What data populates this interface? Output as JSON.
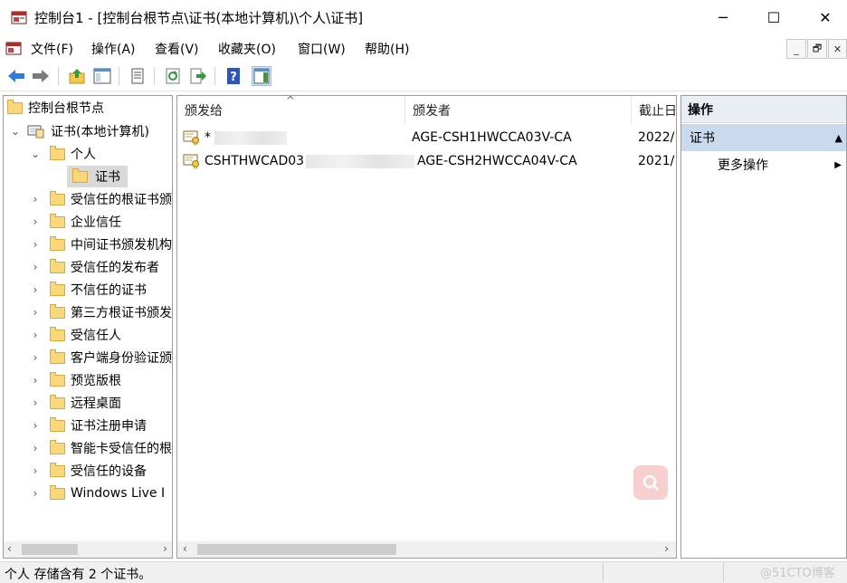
{
  "window": {
    "title": "控制台1 - [控制台根节点\\证书(本地计算机)\\个人\\证书]",
    "min_glyph": "─",
    "max_glyph": "☐",
    "close_glyph": "✕"
  },
  "menu": {
    "items": [
      "文件(F)",
      "操作(A)",
      "查看(V)",
      "收藏夹(O)",
      "窗口(W)",
      "帮助(H)"
    ],
    "mdi": [
      "_",
      "🗗",
      "✕"
    ]
  },
  "toolbar": {
    "icons": [
      "back-arrow-icon",
      "forward-arrow-icon",
      "up-folder-icon",
      "show-hide-tree-icon",
      "properties-icon",
      "refresh-icon",
      "export-list-icon",
      "help-icon",
      "show-hide-action-icon"
    ]
  },
  "tree": {
    "root": "控制台根节点",
    "store": "证书(本地计算机)",
    "personal": "个人",
    "certs": "证书",
    "children": [
      "受信任的根证书颁",
      "企业信任",
      "中间证书颁发机构",
      "受信任的发布者",
      "不信任的证书",
      "第三方根证书颁发",
      "受信任人",
      "客户端身份验证颁",
      "预览版根",
      "远程桌面",
      "证书注册申请",
      "智能卡受信任的根",
      "受信任的设备",
      "Windows Live I"
    ]
  },
  "list": {
    "columns": [
      "颁发给",
      "颁发者",
      "截止日"
    ],
    "sort_glyph": "^",
    "rows": [
      {
        "issued_to": "*",
        "issued_by": "AGE-CSH1HWCCA03V-CA",
        "expires": "2022/"
      },
      {
        "issued_to": "CSHTHWCAD03",
        "issued_by": "AGE-CSH2HWCCA04V-CA",
        "expires": "2021/"
      }
    ]
  },
  "actions": {
    "header": "操作",
    "section": "证书",
    "section_glyph": "▲",
    "more": "更多操作",
    "more_glyph": "▶"
  },
  "status": {
    "text": "个人 存储含有 2 个证书。",
    "watermark": "@51CTO博客"
  },
  "colors": {
    "action_section_bg": "#c9d9ee",
    "action_header_bg": "#e9eef5",
    "selected_tree_bg": "#d9d9d9",
    "help_icon": "#2a57b8",
    "search_badge": "#f8cfcf"
  }
}
